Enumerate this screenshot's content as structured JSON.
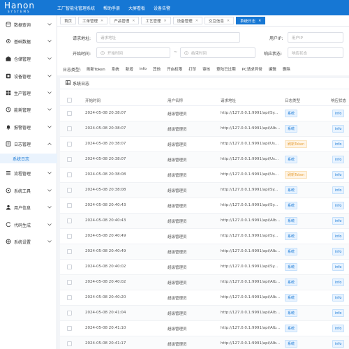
{
  "brand": {
    "main": "Hanon",
    "sub": "SYSTEMS"
  },
  "topnav": [
    "工厂智能化管理系统",
    "帮助手册",
    "大屏看板",
    "设备告警"
  ],
  "sidebar": {
    "items": [
      {
        "label": "数据查询",
        "icon": "database-icon"
      },
      {
        "label": "基础数据",
        "icon": "gear-icon"
      },
      {
        "label": "仓储管理",
        "icon": "warehouse-icon"
      },
      {
        "label": "设备管理",
        "icon": "device-icon"
      },
      {
        "label": "生产管理",
        "icon": "production-icon"
      },
      {
        "label": "能耗管理",
        "icon": "energy-icon"
      },
      {
        "label": "报警管理",
        "icon": "bell-icon"
      },
      {
        "label": "日志管理",
        "icon": "log-icon"
      }
    ],
    "sub_item": "系统日志",
    "items2": [
      {
        "label": "流程管理",
        "icon": "flow-icon"
      },
      {
        "label": "系统工具",
        "icon": "tools-icon"
      },
      {
        "label": "用户信息",
        "icon": "user-icon"
      },
      {
        "label": "代码生成",
        "icon": "code-icon"
      },
      {
        "label": "系统设置",
        "icon": "settings-icon"
      }
    ]
  },
  "tabs": [
    "首页",
    "工单管理",
    "产品管理",
    "工艺管理",
    "设备管理",
    "交互信息",
    "系统日志"
  ],
  "search": {
    "url_label": "请求地址:",
    "url_placeholder": "请求地址",
    "ip_label": "用户IP:",
    "ip_placeholder": "用户IP",
    "start_label": "开始时间:",
    "start_placeholder": "开始时间",
    "end_placeholder": "结束时间",
    "range_sep": "~",
    "status_label": "响应状态:",
    "status_placeholder": "响应状态"
  },
  "filter": {
    "label": "日志类型:",
    "options": [
      "刷新Token",
      "系统",
      "新增",
      "info",
      "其他",
      "开启权限",
      "打印",
      "审核",
      "登陆已过期",
      "PC请求异常",
      "编辑",
      "删除"
    ]
  },
  "panel_title": "系统日志",
  "table": {
    "headers": [
      "开始时间",
      "用户名称",
      "请求地址",
      "日志类型",
      "响应状态"
    ],
    "rows": [
      {
        "time": "2024-05-08 20:38:07",
        "user": "超级管理员",
        "url": "http://127.0.0.1:9991/api/Sy...",
        "type": "系统",
        "type_color": "blue",
        "status": "info"
      },
      {
        "time": "2024-05-08 20:38:07",
        "user": "超级管理员",
        "url": "http://127.0.0.1:9991/api/Alb...",
        "type": "系统",
        "type_color": "blue",
        "status": "info"
      },
      {
        "time": "2024-05-08 20:38:07",
        "user": "超级管理员",
        "url": "http://127.0.0.1:9991/api/Us...",
        "type": "刷新Token",
        "type_color": "orange",
        "status": "info"
      },
      {
        "time": "2024-05-08 20:38:07",
        "user": "超级管理员",
        "url": "http://127.0.0.1:9991/api/Us...",
        "type": "系统",
        "type_color": "blue",
        "status": "info"
      },
      {
        "time": "2024-05-08 20:38:08",
        "user": "超级管理员",
        "url": "http://127.0.0.1:9991/api/Us...",
        "type": "刷新Token",
        "type_color": "orange",
        "status": "info"
      },
      {
        "time": "2024-05-08 20:38:08",
        "user": "超级管理员",
        "url": "http://127.0.0.1:9991/api/Sy...",
        "type": "系统",
        "type_color": "blue",
        "status": "info"
      },
      {
        "time": "2024-05-08 20:40:43",
        "user": "超级管理员",
        "url": "http://127.0.0.1:9991/api/Sy...",
        "type": "系统",
        "type_color": "blue",
        "status": "info"
      },
      {
        "time": "2024-05-08 20:40:43",
        "user": "超级管理员",
        "url": "http://127.0.0.1:9991/api/Alb...",
        "type": "系统",
        "type_color": "blue",
        "status": "info"
      },
      {
        "time": "2024-05-08 20:40:49",
        "user": "超级管理员",
        "url": "http://127.0.0.1:9991/api/Sy...",
        "type": "系统",
        "type_color": "blue",
        "status": "info"
      },
      {
        "time": "2024-05-08 20:40:49",
        "user": "超级管理员",
        "url": "http://127.0.0.1:9991/api/Alb...",
        "type": "系统",
        "type_color": "blue",
        "status": "info"
      },
      {
        "time": "2024-05-08 20:40:02",
        "user": "超级管理员",
        "url": "http://127.0.0.1:9991/api/Sy...",
        "type": "系统",
        "type_color": "blue",
        "status": "info"
      },
      {
        "time": "2024-05-08 20:40:02",
        "user": "超级管理员",
        "url": "http://127.0.0.1:9991/api/Alb...",
        "type": "系统",
        "type_color": "blue",
        "status": "info"
      },
      {
        "time": "2024-05-08 20:40:20",
        "user": "超级管理员",
        "url": "http://127.0.0.1:9991/api/Alb...",
        "type": "系统",
        "type_color": "blue",
        "status": "info"
      },
      {
        "time": "2024-05-08 20:41:04",
        "user": "超级管理员",
        "url": "http://127.0.0.1:9991/api/Alb...",
        "type": "系统",
        "type_color": "blue",
        "status": "info"
      },
      {
        "time": "2024-05-08 20:41:10",
        "user": "超级管理员",
        "url": "http://127.0.0.1:9991/api/Alb...",
        "type": "系统",
        "type_color": "blue",
        "status": "info"
      },
      {
        "time": "2024-05-08 20:41:17",
        "user": "超级管理员",
        "url": "http://127.0.0.1:9991/api/Alb...",
        "type": "系统",
        "type_color": "blue",
        "status": "info"
      }
    ]
  },
  "colors": {
    "primary": "#1677d4",
    "tag_blue_bg": "#e8f3ff",
    "tag_orange": "#e6a23c"
  }
}
